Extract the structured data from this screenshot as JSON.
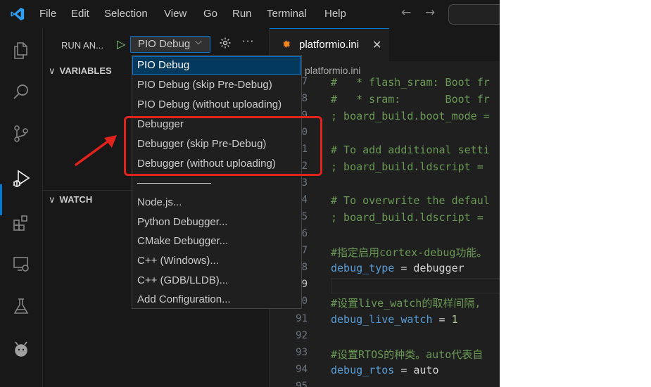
{
  "menu": [
    "File",
    "Edit",
    "Selection",
    "View",
    "Go",
    "Run",
    "Terminal",
    "Help"
  ],
  "sidebar": {
    "title": "RUN AN...",
    "selected_config": "PIO Debug",
    "sections": [
      "VARIABLES",
      "WATCH"
    ]
  },
  "dropdown": {
    "items": [
      "PIO Debug",
      "PIO Debug (skip Pre-Debug)",
      "PIO Debug (without uploading)",
      "Debugger",
      "Debugger (skip Pre-Debug)",
      "Debugger (without uploading)"
    ],
    "separator": "──────────",
    "other_items": [
      "Node.js...",
      "Python Debugger...",
      "CMake Debugger...",
      "C++ (Windows)...",
      "C++ (GDB/LLDB)...",
      "Add Configuration..."
    ]
  },
  "editor": {
    "tab_label": "platformio.ini",
    "breadcrumb": "platformio.ini",
    "line_numbers": [
      "7",
      "8",
      "9",
      "0",
      "1",
      "2",
      "3",
      "4",
      "5",
      "6",
      "7",
      "8",
      "9",
      "0",
      "91",
      "92",
      "93",
      "94",
      "95"
    ],
    "code": {
      "l1": "#   * flash_sram: Boot fr",
      "l2": "#   * sram:       Boot fr",
      "l3": "; board_build.boot_mode =",
      "l4": "# To add additional setti",
      "l5": "; board_build.ldscript =",
      "l6": "# To overwrite the defaul",
      "l7": "; board_build.ldscript =",
      "l8": "#指定启用cortex-debug功能。",
      "l9_key": "debug_type",
      "l9_op": " = ",
      "l9_val": "debugger",
      "l10": "#设置live_watch的取样间隔,",
      "l11_key": "debug_live_watch",
      "l11_op": " = ",
      "l11_val": "1",
      "l12": "#设置RTOS的种类。auto代表自",
      "l13_key": "debug_rtos",
      "l13_op": " = ",
      "l13_val": "auto"
    }
  },
  "colors": {
    "accent": "#0078d4",
    "annotation": "#e0231c",
    "comment": "#6a9955",
    "key": "#569cd6"
  }
}
